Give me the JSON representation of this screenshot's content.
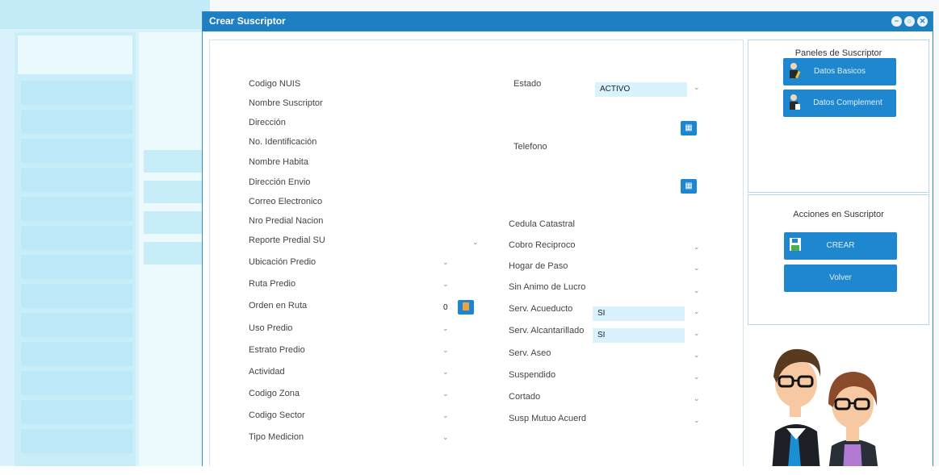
{
  "dialog": {
    "title": "Crear Suscriptor",
    "window_buttons": [
      "−",
      "○",
      "✕"
    ]
  },
  "form": {
    "left_fields": [
      {
        "label": "Codigo NUIS",
        "value": ""
      },
      {
        "label": "Nombre Suscriptor",
        "value": ""
      },
      {
        "label": "Dirección",
        "value": ""
      },
      {
        "label": "No. Identificación",
        "value": ""
      },
      {
        "label": "Nombre Habita",
        "value": ""
      },
      {
        "label": "Dirección Envio",
        "value": ""
      },
      {
        "label": "Correo Electronico",
        "value": ""
      },
      {
        "label": "Nro Predial Nacion",
        "value": ""
      },
      {
        "label": "Reporte Predial SU",
        "value": ""
      },
      {
        "label": "Ubicación Predio",
        "value": ""
      },
      {
        "label": "Ruta Predio",
        "value": ""
      },
      {
        "label": "Orden en Ruta",
        "value": "0"
      },
      {
        "label": "Uso Predio",
        "value": ""
      },
      {
        "label": "Estrato Predio",
        "value": ""
      },
      {
        "label": "Actividad",
        "value": ""
      },
      {
        "label": "Codigo Zona",
        "value": ""
      },
      {
        "label": "Codigo Sector",
        "value": ""
      },
      {
        "label": "Tipo Medicion",
        "value": ""
      }
    ],
    "right_fields": [
      {
        "label": "Estado",
        "value": "ACTIVO"
      },
      {
        "label": "Telefono",
        "value": ""
      },
      {
        "label": "Cedula Catastral",
        "value": ""
      },
      {
        "label": "Cobro Reciproco",
        "value": ""
      },
      {
        "label": "Hogar de Paso",
        "value": ""
      },
      {
        "label": "Sin Animo de Lucro",
        "value": ""
      },
      {
        "label": "Serv. Acueducto",
        "value": "SI"
      },
      {
        "label": "Serv. Alcantarillado",
        "value": "SI"
      },
      {
        "label": "Serv. Aseo",
        "value": ""
      },
      {
        "label": "Suspendido",
        "value": ""
      },
      {
        "label": "Cortado",
        "value": ""
      },
      {
        "label": "Susp Mutuo Acuerd",
        "value": ""
      }
    ]
  },
  "panels": {
    "title": "Paneles de Suscriptor",
    "datos_basicos": "Datos Basicos",
    "datos_complement": "Datos Complement"
  },
  "actions": {
    "title": "Acciones en Suscriptor",
    "crear": "CREAR",
    "volver": "Volver"
  },
  "colors": {
    "titlebar": "#1f7fc3",
    "button": "#1f86d0",
    "select_bg": "#d9f2fb"
  }
}
